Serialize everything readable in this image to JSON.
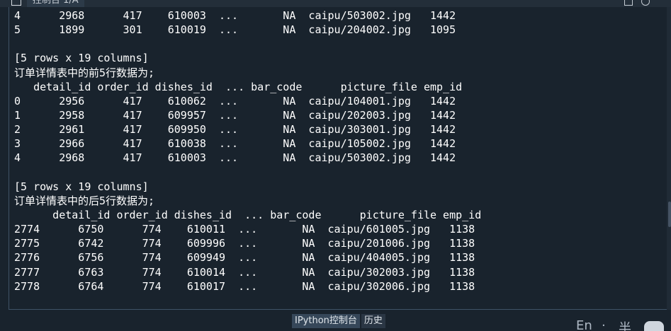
{
  "window": {
    "tab_title": "控制台 1/A"
  },
  "console": {
    "lines": [
      "4      2968      417    610003  ...       NA  caipu/503002.jpg   1442",
      "5      1899      301    610019  ...       NA  caipu/204002.jpg   1095",
      "",
      "[5 rows x 19 columns]",
      "订单详情表中的前5行数据为;",
      "   detail_id order_id dishes_id  ... bar_code      picture_file emp_id",
      "0      2956      417    610062  ...       NA  caipu/104001.jpg   1442",
      "1      2958      417    609957  ...       NA  caipu/202003.jpg   1442",
      "2      2961      417    609950  ...       NA  caipu/303001.jpg   1442",
      "3      2966      417    610038  ...       NA  caipu/105002.jpg   1442",
      "4      2968      417    610003  ...       NA  caipu/503002.jpg   1442",
      "",
      "[5 rows x 19 columns]",
      "订单详情表中的后5行数据为;",
      "      detail_id order_id dishes_id  ... bar_code      picture_file emp_id",
      "2774      6750      774    610011  ...       NA  caipu/601005.jpg   1138",
      "2775      6742      774    609996  ...       NA  caipu/201006.jpg   1138",
      "2776      6756      774    609949  ...       NA  caipu/404005.jpg   1138",
      "2777      6763      774    610014  ...       NA  caipu/302003.jpg   1138",
      "2778      6764      774    610017  ...       NA  caipu/302006.jpg   1138"
    ]
  },
  "bottom_tabs": [
    {
      "label": "IPython控制台",
      "active": true
    },
    {
      "label": "历史",
      "active": false
    }
  ],
  "ime": {
    "mode_label": "En",
    "dot": "·",
    "half_width": "半"
  }
}
